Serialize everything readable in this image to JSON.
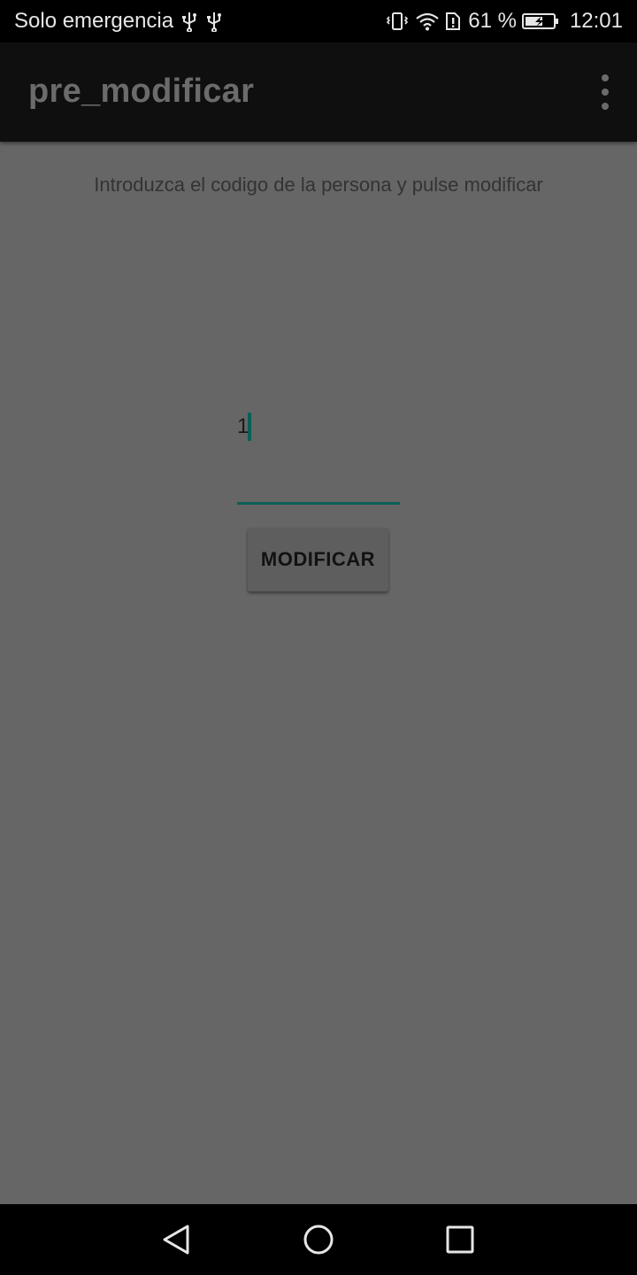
{
  "status_bar": {
    "carrier": "Solo emergencia",
    "battery_percent": "61 %",
    "time": "12:01",
    "icons": [
      "usb-icon",
      "usb-icon",
      "vibrate-icon",
      "wifi-icon",
      "sim-alert-icon",
      "battery-charging-icon"
    ]
  },
  "toolbar": {
    "title": "pre_modificar",
    "overflow_icon": "more-vert-icon"
  },
  "main": {
    "instructions": "Introduzca el codigo de la persona y pulse modificar",
    "code_input_value": "1",
    "modify_button_label": "MODIFICAR"
  },
  "nav_bar": {
    "icons": [
      "back-icon",
      "home-icon",
      "recents-icon"
    ]
  },
  "colors": {
    "background": "#666666",
    "accent": "#0b5f57",
    "toolbar": "#0f0f0f",
    "status_bar": "#000000"
  }
}
